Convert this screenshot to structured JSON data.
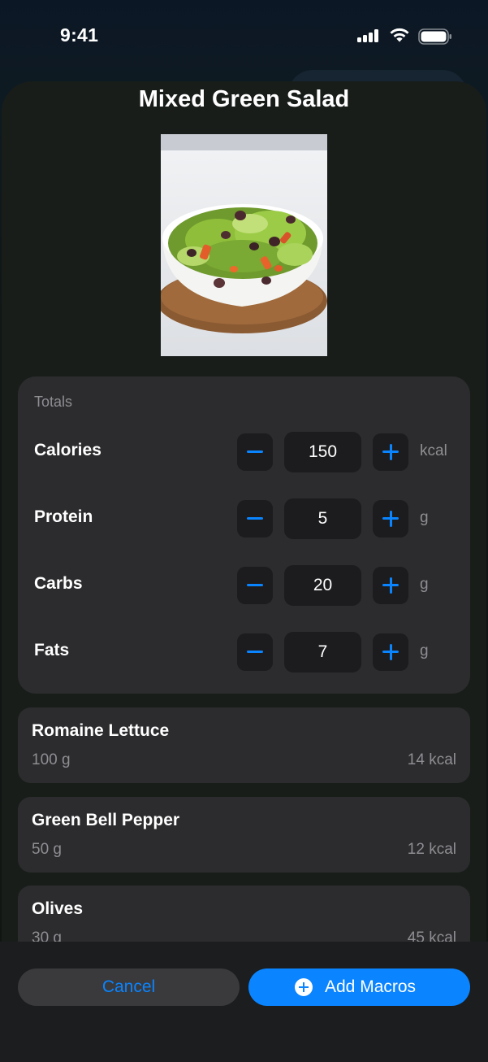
{
  "status_bar": {
    "time": "9:41"
  },
  "meal": {
    "title": "Mixed Green Salad"
  },
  "totals": {
    "heading": "Totals",
    "rows": [
      {
        "label": "Calories",
        "value": "150",
        "unit": "kcal"
      },
      {
        "label": "Protein",
        "value": "5",
        "unit": "g"
      },
      {
        "label": "Carbs",
        "value": "20",
        "unit": "g"
      },
      {
        "label": "Fats",
        "value": "7",
        "unit": "g"
      }
    ]
  },
  "ingredients": [
    {
      "name": "Romaine Lettuce",
      "quantity": "100 g",
      "kcal": "14 kcal"
    },
    {
      "name": "Green Bell Pepper",
      "quantity": "50 g",
      "kcal": "12 kcal"
    },
    {
      "name": "Olives",
      "quantity": "30 g",
      "kcal": "45 kcal"
    }
  ],
  "actions": {
    "cancel_label": "Cancel",
    "add_label": "Add Macros"
  },
  "colors": {
    "accent": "#0a84ff",
    "card": "#2c2c2e",
    "secondary_text": "#8e8e93"
  },
  "icons": {
    "minus": "minus-icon",
    "plus": "plus-icon",
    "add": "plus-circle-icon"
  }
}
